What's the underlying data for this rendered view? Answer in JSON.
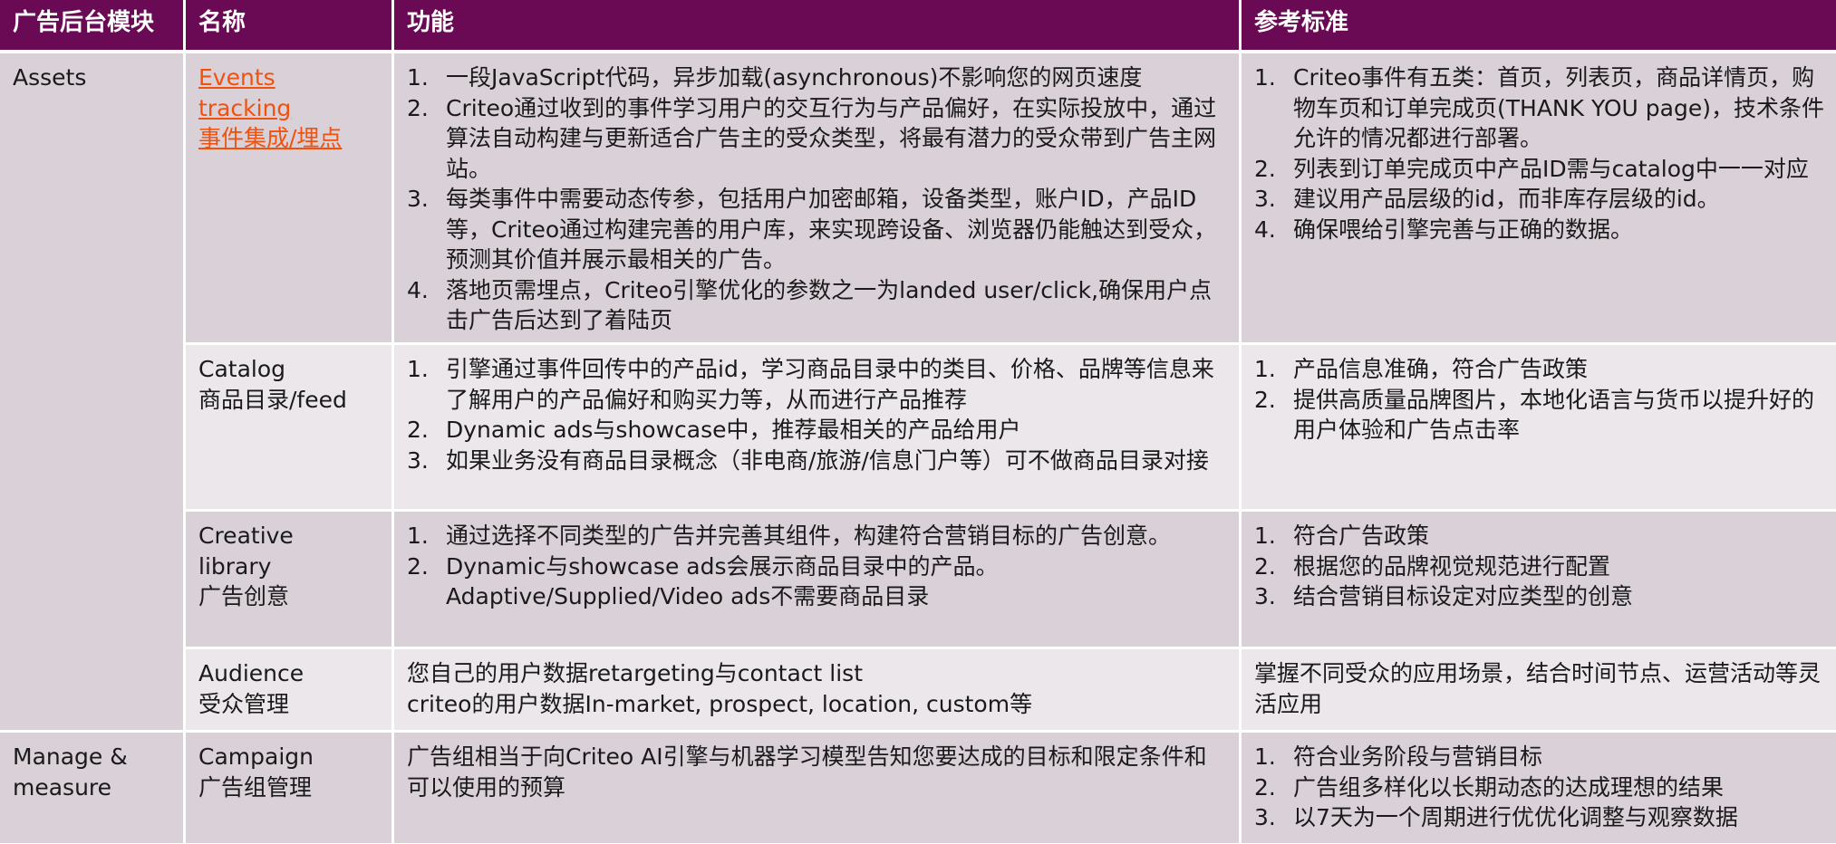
{
  "headers": [
    "广告后台模块",
    "名称",
    "功能",
    "参考标准"
  ],
  "modules": {
    "assets": "Assets",
    "manage": "Manage & measure"
  },
  "rows": [
    {
      "name_lines": [
        "Events",
        "tracking",
        "事件集成/埋点"
      ],
      "name_is_link": true,
      "functions": [
        "一段JavaScript代码，异步加载(asynchronous)不影响您的网页速度",
        "Criteo通过收到的事件学习用户的交互行为与产品偏好，在实际投放中，通过算法自动构建与更新适合广告主的受众类型，将最有潜力的受众带到广告主网站。",
        "每类事件中需要动态传参，包括用户加密邮箱，设备类型，账户ID，产品ID等，Criteo通过构建完善的用户库，来实现跨设备、浏览器仍能触达到受众，预测其价值并展示最相关的广告。",
        "落地页需埋点，Criteo引擎优化的参数之一为landed user/click,确保用户点击广告后达到了着陆页"
      ],
      "standards": [
        "Criteo事件有五类：首页，列表页，商品详情页，购物车页和订单完成页(THANK YOU page)，技术条件允许的情况都进行部署。",
        "列表到订单完成页中产品ID需与catalog中一一对应",
        "建议用产品层级的id，而非库存层级的id。",
        "确保喂给引擎完善与正确的数据。"
      ]
    },
    {
      "name_lines": [
        "Catalog",
        "商品目录/feed"
      ],
      "name_is_link": false,
      "functions": [
        "引擎通过事件回传中的产品id，学习商品目录中的类目、价格、品牌等信息来了解用户的产品偏好和购买力等，从而进行产品推荐",
        "Dynamic ads与showcase中，推荐最相关的产品给用户",
        "如果业务没有商品目录概念（非电商/旅游/信息门户等）可不做商品目录对接"
      ],
      "standards": [
        "产品信息准确，符合广告政策",
        "提供高质量品牌图片，本地化语言与货币以提升好的用户体验和广告点击率"
      ]
    },
    {
      "name_lines": [
        "Creative",
        "library",
        "广告创意"
      ],
      "name_is_link": false,
      "functions": [
        "通过选择不同类型的广告并完善其组件，构建符合营销目标的广告创意。",
        "Dynamic与showcase ads会展示商品目录中的产品。Adaptive/Supplied/Video ads不需要商品目录"
      ],
      "standards": [
        "符合广告政策",
        "根据您的品牌视觉规范进行配置",
        "结合营销目标设定对应类型的创意"
      ]
    },
    {
      "name_lines": [
        "Audience",
        "受众管理"
      ],
      "name_is_link": false,
      "function_lines": [
        "您自己的用户数据retargeting与contact list",
        "criteo的用户数据In-market, prospect, location, custom等"
      ],
      "standard_text": "掌握不同受众的应用场景，结合时间节点、运营活动等灵活应用"
    },
    {
      "name_lines": [
        "Campaign",
        "广告组管理"
      ],
      "name_is_link": false,
      "function_text": "广告组相当于向Criteo AI引擎与机器学习模型告知您要达成的目标和限定条件和可以使用的预算",
      "standards": [
        "符合业务阶段与营销目标",
        "广告组多样化以长期动态的达成理想的结果",
        "以7天为一个周期进行优优化调整与观察数据"
      ]
    }
  ]
}
